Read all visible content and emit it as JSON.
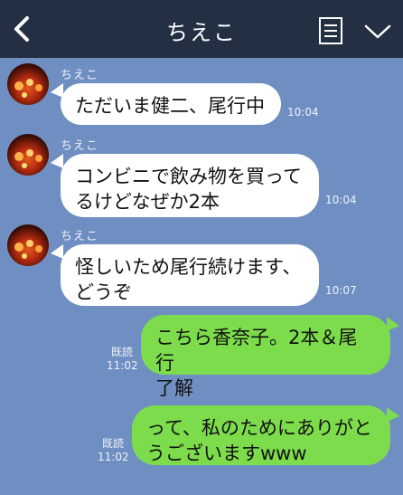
{
  "header": {
    "title": "ちえこ",
    "back_icon": "chevron-left-icon",
    "memo_icon": "notes-icon",
    "menu_icon": "chevron-down-icon"
  },
  "messages": [
    {
      "sender": "ちえこ",
      "text_lines": [
        "ただいま健二、尾行中"
      ],
      "time": "10:04",
      "direction": "in"
    },
    {
      "sender": "ちえこ",
      "text_lines": [
        "コンビニで飲み物を買って",
        "るけどなぜか2本"
      ],
      "time": "10:04",
      "direction": "in"
    },
    {
      "sender": "ちえこ",
      "text_lines": [
        "怪しいため尾行続けます、",
        "どうぞ"
      ],
      "time": "10:07",
      "direction": "in"
    },
    {
      "read": "既読",
      "text_lines": [
        "こちら香奈子。2本＆尾行",
        "了解"
      ],
      "time": "11:02",
      "direction": "out"
    },
    {
      "read": "既読",
      "text_lines": [
        "って、私のためにありがと",
        "うございますwww"
      ],
      "time": "11:02",
      "direction": "out"
    }
  ],
  "colors": {
    "background": "#6f8fc2",
    "header": "#233044",
    "outgoing_bubble": "#7ddc4c",
    "incoming_bubble": "#ffffff"
  }
}
